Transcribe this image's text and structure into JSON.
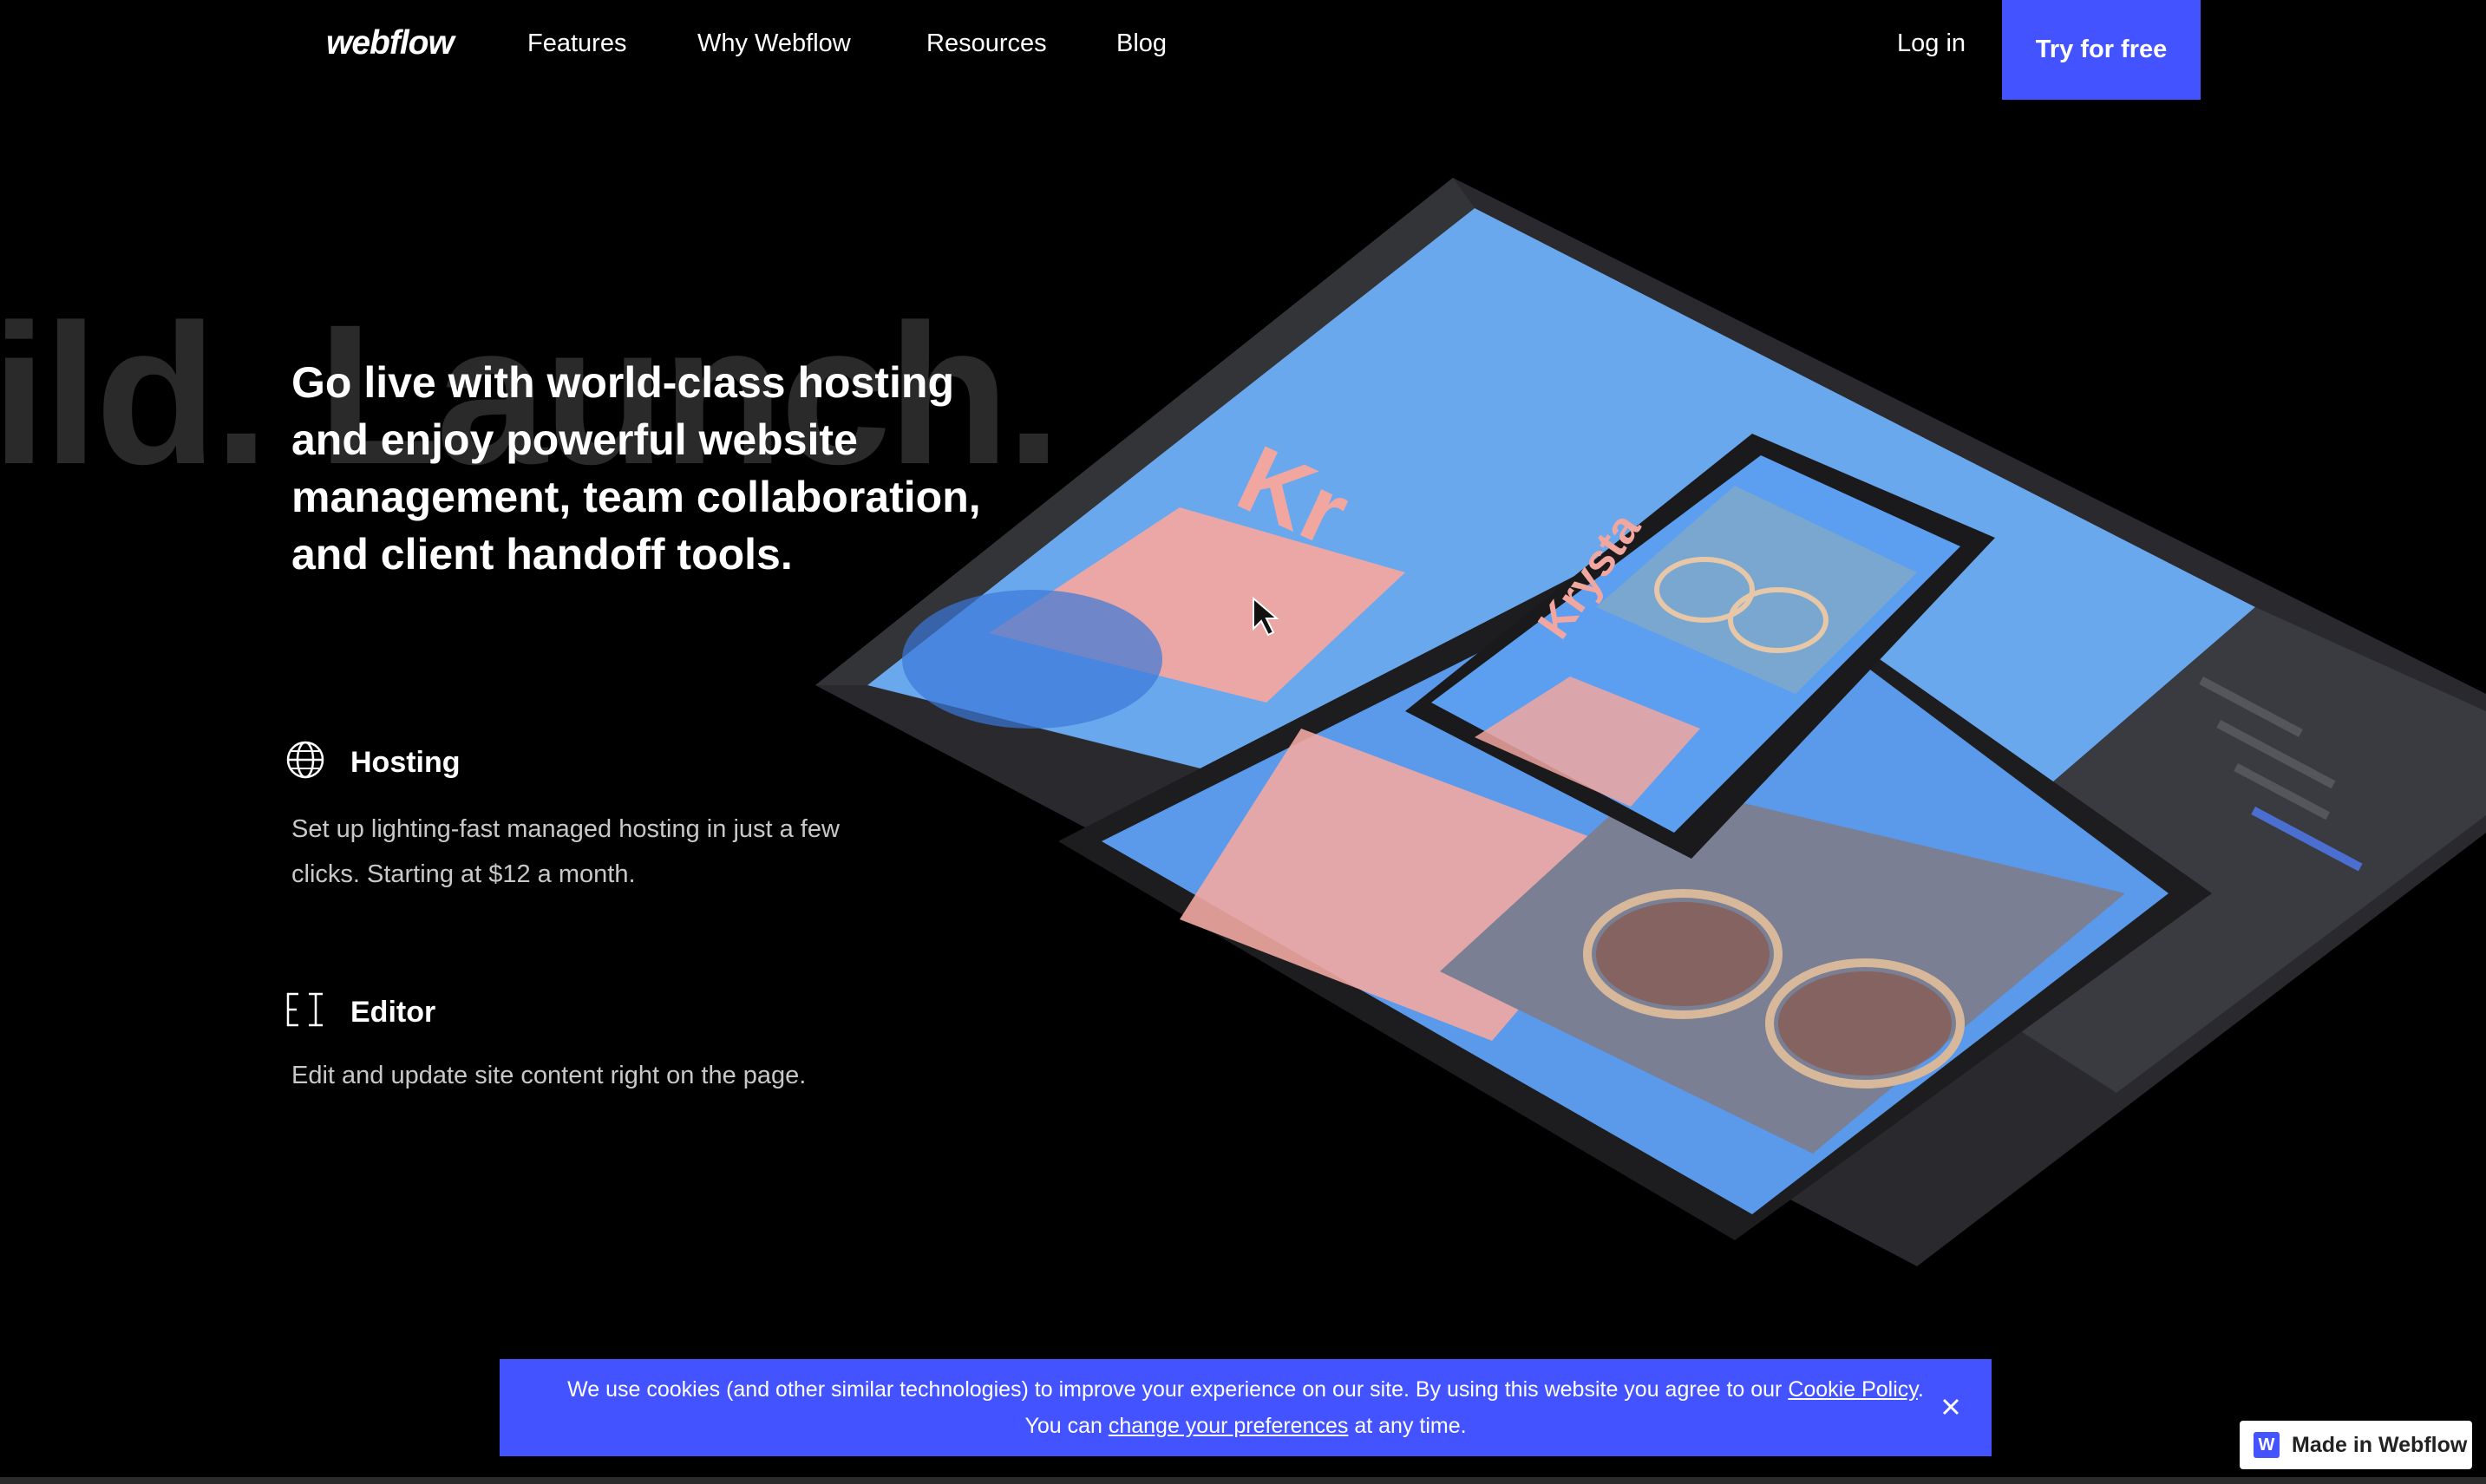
{
  "nav": {
    "logo": "webflow",
    "links": [
      "Features",
      "Why Webflow",
      "Resources",
      "Blog"
    ],
    "login": "Log in",
    "cta": "Try for free"
  },
  "background_text": "ild. Launch.",
  "hero": {
    "headline": "Go live with world-class hosting and enjoy powerful website management, team collaboration, and client handoff tools."
  },
  "features": [
    {
      "title": "Hosting",
      "description": "Set up lighting-fast managed hosting in just a few clicks. Starting at $12 a month.",
      "icon": "globe-icon"
    },
    {
      "title": "Editor",
      "description": "Edit and update site content right on the page.",
      "icon": "editor-icon"
    }
  ],
  "illustration": {
    "mock_text_1": "Kr",
    "mock_text_2": "Krysta"
  },
  "cookie": {
    "line1_prefix": "We use cookies (and other similar technologies) to improve your experience on our site. By using this website you agree to our ",
    "policy_link": "Cookie Policy",
    "line1_suffix": ".",
    "line2_prefix": "You can ",
    "prefs_link": "change your preferences",
    "line2_suffix": " at any time."
  },
  "badge": {
    "logo": "W",
    "label": "Made in Webflow"
  },
  "colors": {
    "accent": "#4353ff",
    "background": "#000000"
  }
}
